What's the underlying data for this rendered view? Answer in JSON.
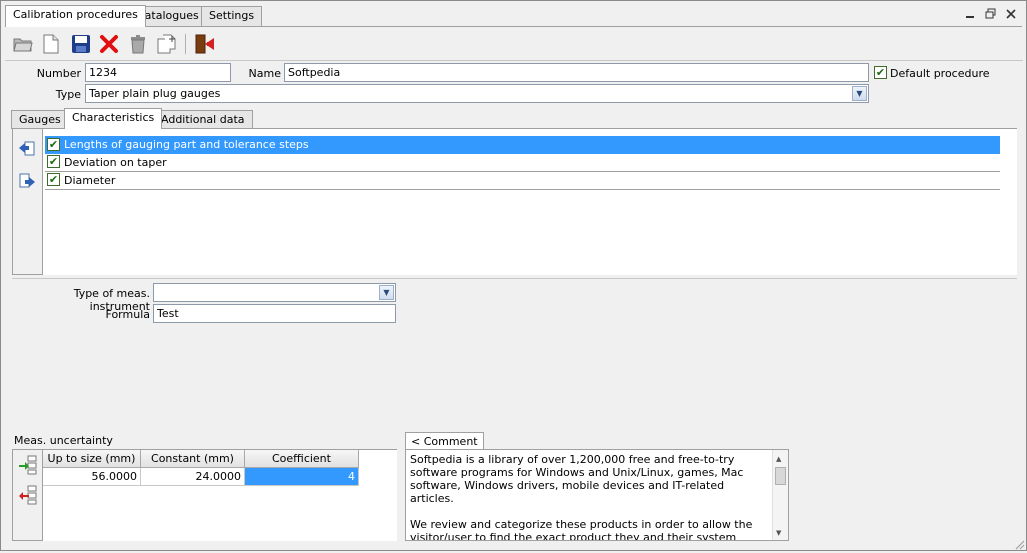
{
  "tabs": [
    "Calibration procedures",
    "Catalogues",
    "Settings"
  ],
  "form": {
    "number_label": "Number",
    "number_value": "1234",
    "name_label": "Name",
    "name_value": "Softpedia",
    "default_label": "Default procedure",
    "type_label": "Type",
    "type_value": "Taper plain plug gauges"
  },
  "subtabs": [
    "Gauges",
    "Characteristics",
    "Additional data"
  ],
  "characteristics": [
    "Lengths of gauging part and tolerance steps",
    "Deviation on taper",
    "Diameter"
  ],
  "instrument": {
    "type_label": "Type of meas. instrument",
    "type_value": "",
    "formula_label": "Formula",
    "formula_value": "Test"
  },
  "uncertainty": {
    "label": "Meas. uncertainty",
    "headers": [
      "Up to size (mm)",
      "Constant (mm)",
      "Coefficient"
    ],
    "rows": [
      [
        "56.0000",
        "24.0000",
        "4"
      ]
    ]
  },
  "comment": {
    "tab_label": "< Comment",
    "paragraph1": "Softpedia is a library of over 1,200,000 free and free-to-try software programs for Windows and Unix/Linux, games, Mac software, Windows drivers, mobile devices and IT-related articles.",
    "paragraph2": "We review and categorize these products in order to allow the visitor/user to find the exact product they and their system needs. We strive to"
  },
  "colors": {
    "selection": "#3399ff",
    "border": "#a0a0a0"
  }
}
